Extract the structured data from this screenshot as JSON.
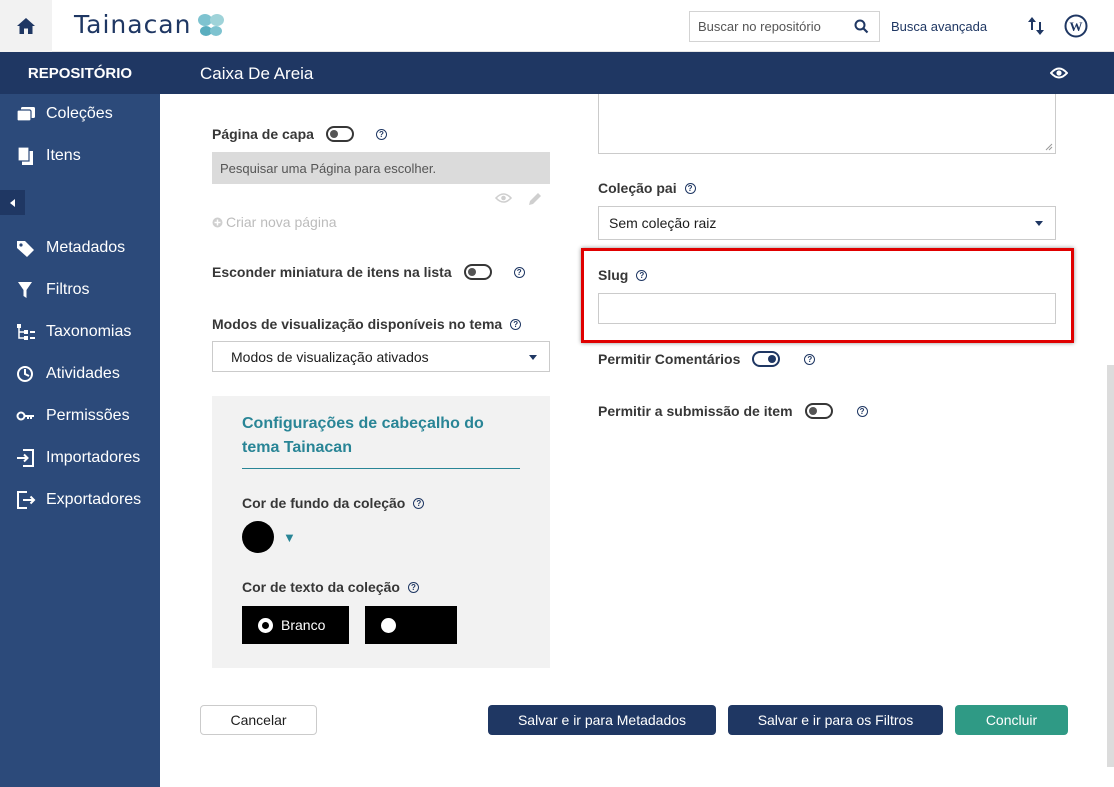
{
  "topbar": {
    "logo_text": "Tainacan",
    "search_placeholder": "Buscar no repositório",
    "advanced_search": "Busca avançada"
  },
  "header": {
    "repository_label": "REPOSITÓRIO",
    "page_title": "Caixa De Areia"
  },
  "sidebar": {
    "items": [
      {
        "label": "Coleções",
        "icon": "collections-icon"
      },
      {
        "label": "Itens",
        "icon": "items-icon"
      },
      {
        "label": "Metadados",
        "icon": "tag-icon"
      },
      {
        "label": "Filtros",
        "icon": "filter-icon"
      },
      {
        "label": "Taxonomias",
        "icon": "taxonomy-icon"
      },
      {
        "label": "Atividades",
        "icon": "activities-icon"
      },
      {
        "label": "Permissões",
        "icon": "key-icon"
      },
      {
        "label": "Importadores",
        "icon": "import-icon"
      },
      {
        "label": "Exportadores",
        "icon": "export-icon"
      }
    ]
  },
  "form": {
    "cover_page_label": "Página de capa",
    "cover_page_search": "Pesquisar uma Página para escolher.",
    "create_page": "Criar nova página",
    "hide_thumbnails_label": "Esconder miniatura de itens na lista",
    "view_modes_label": "Modos de visualização disponíveis no tema",
    "view_modes_value": "Modos de visualização ativados",
    "theme_header_title": "Configurações de cabeçalho do tema Tainacan",
    "bg_color_label": "Cor de fundo da coleção",
    "text_color_label": "Cor de texto da coleção",
    "text_color_options": [
      "Branco",
      ""
    ],
    "parent_collection_label": "Coleção pai",
    "parent_collection_value": "Sem coleção raiz",
    "slug_label": "Slug",
    "slug_value": "",
    "allow_comments_label": "Permitir Comentários",
    "allow_comments_on": true,
    "allow_submission_label": "Permitir a submissão de item",
    "allow_submission_on": false
  },
  "footer": {
    "cancel": "Cancelar",
    "save_metadata": "Salvar e ir para Metadados",
    "save_filters": "Salvar e ir para os Filtros",
    "finish": "Concluir"
  },
  "colors": {
    "primary": "#1f3763",
    "sidebar": "#2c4a7a",
    "accent_teal": "#298596",
    "success": "#2f9a85",
    "highlight": "#e00000"
  }
}
